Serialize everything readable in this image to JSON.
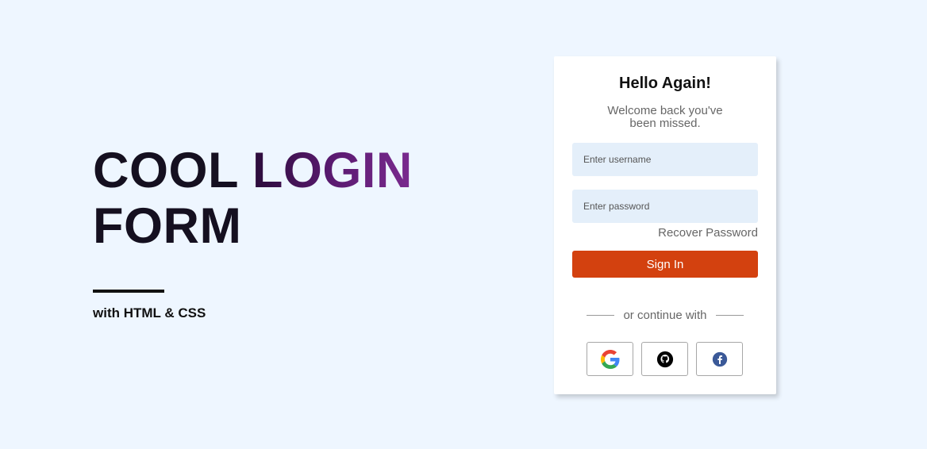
{
  "hero": {
    "title_line1_part1": "COOL",
    "title_line1_part2": "LOGIN",
    "title_line2": "FORM",
    "subtitle": "with HTML & CSS"
  },
  "login": {
    "title": "Hello Again!",
    "subtitle": "Welcome back you've been missed.",
    "username_placeholder": "Enter username",
    "password_placeholder": "Enter password",
    "recover_label": "Recover Password",
    "signin_label": "Sign In",
    "divider_text": "or continue with",
    "social": [
      {
        "icon": "google-icon"
      },
      {
        "icon": "github-icon"
      },
      {
        "icon": "facebook-icon"
      }
    ]
  },
  "colors": {
    "background": "#eef6ff",
    "accent_button": "#d3410f",
    "input_bg": "#e4effa",
    "title_gradient": "#5a1a70"
  }
}
